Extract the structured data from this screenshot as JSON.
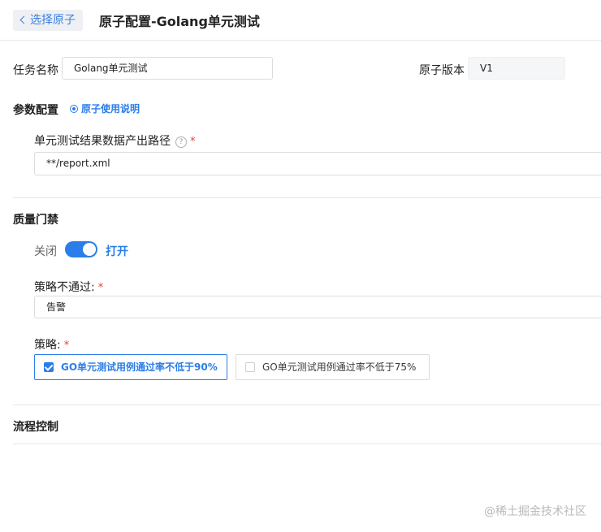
{
  "header": {
    "back_label": "选择原子",
    "title": "原子配置-Golang单元测试"
  },
  "basic": {
    "task_name_label": "任务名称",
    "task_name_value": "Golang单元测试",
    "atom_version_label": "原子版本",
    "atom_version_value": "V1"
  },
  "params": {
    "section_title": "参数配置",
    "usage_link": "原子使用说明",
    "path_label": "单元测试结果数据产出路径",
    "path_required": "*",
    "path_value": "**/report.xml"
  },
  "quality_gate": {
    "section_title": "质量门禁",
    "toggle_off_label": "关闭",
    "toggle_on_label": "打开",
    "toggle_state": "on",
    "fail_label": "策略不通过:",
    "fail_required": "*",
    "fail_value": "告警",
    "strategy_label": "策略:",
    "strategy_required": "*",
    "strategies": [
      {
        "label": "GO单元测试用例通过率不低于90%",
        "checked": true
      },
      {
        "label": "GO单元测试用例通过率不低于75%",
        "checked": false
      }
    ]
  },
  "flow_control": {
    "section_title": "流程控制"
  },
  "watermark": "@稀土掘金技术社区",
  "colors": {
    "accent": "#2b7de9",
    "required": "#e0453a",
    "divider": "#e8e8e8"
  }
}
